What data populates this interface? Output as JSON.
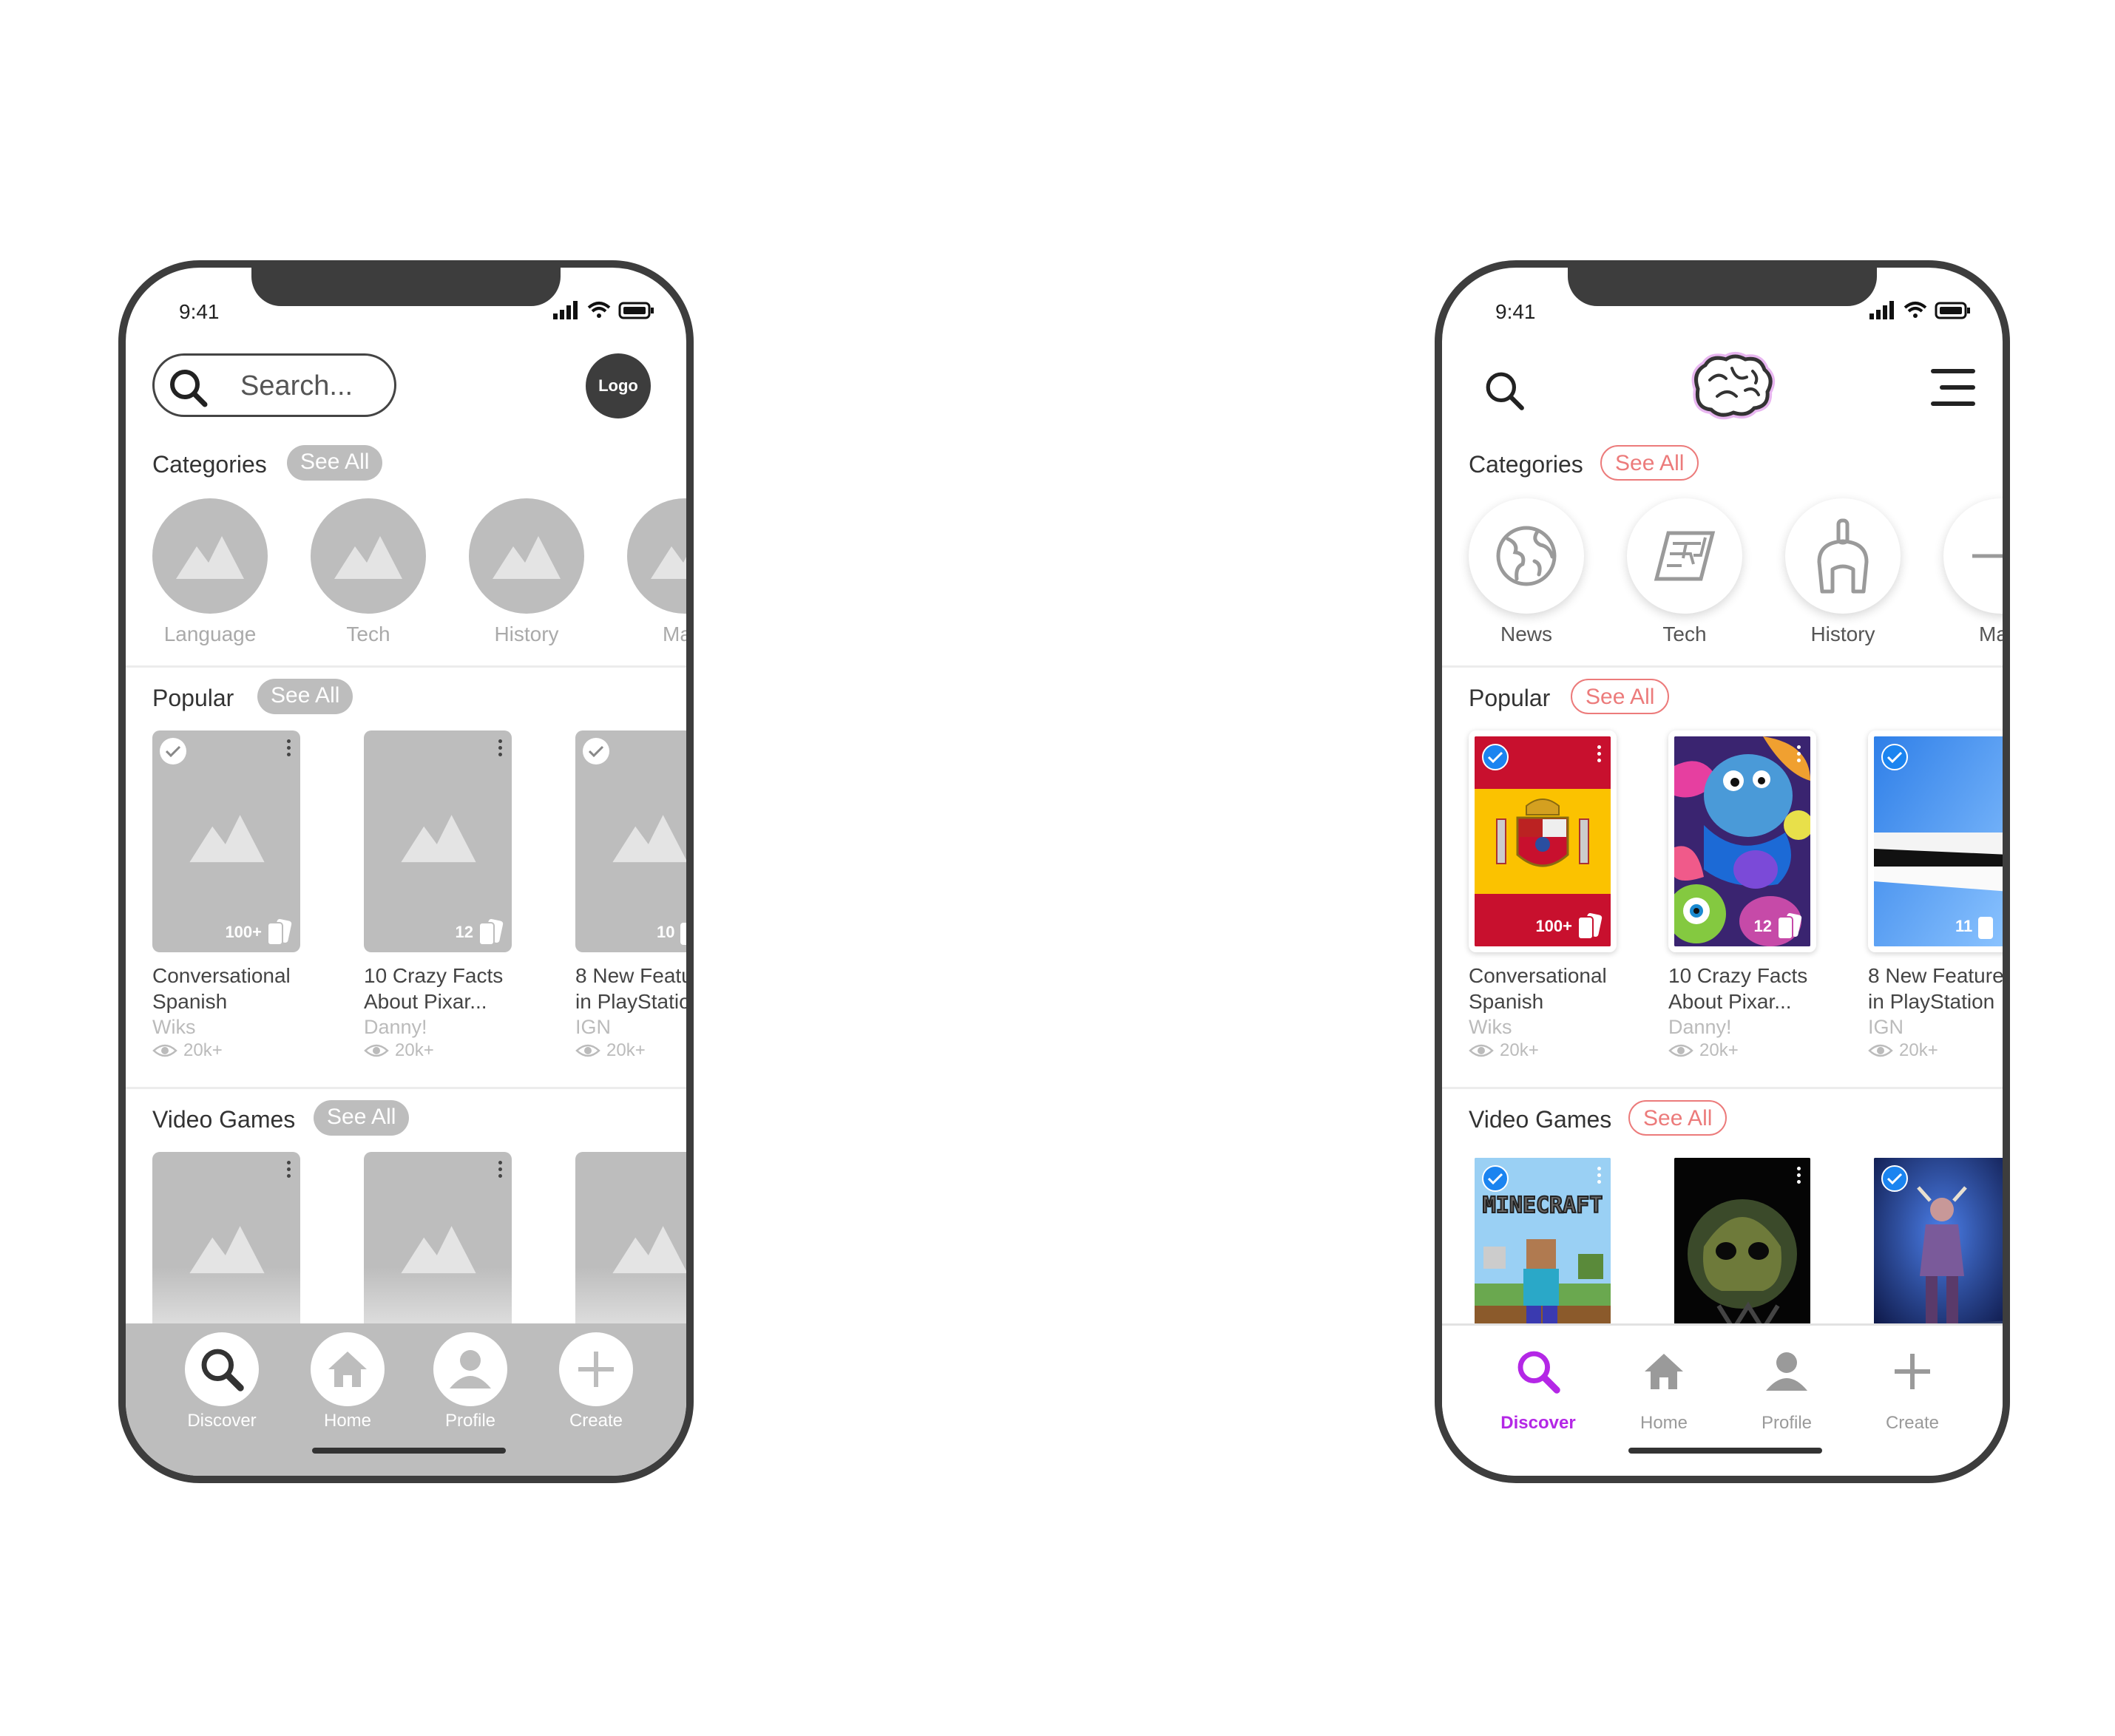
{
  "status": {
    "time": "9:41"
  },
  "search": {
    "placeholder": "Search..."
  },
  "logo_text": "Logo",
  "sections": {
    "categories": "Categories",
    "popular": "Popular",
    "video_games": "Video Games",
    "see_all": "See All"
  },
  "wire_categories": [
    "Language",
    "Tech",
    "History",
    "Ma"
  ],
  "hifi_categories": [
    "News",
    "Tech",
    "History",
    "Ma"
  ],
  "wire_popular": [
    {
      "title1": "Conversational",
      "title2": "Spanish",
      "author": "Wiks",
      "views": "20k+",
      "count": "100+",
      "checked": true
    },
    {
      "title1": "10 Crazy Facts",
      "title2": "About Pixar...",
      "author": "Danny!",
      "views": "20k+",
      "count": "12",
      "checked": false
    },
    {
      "title1": "8 New Featu",
      "title2": "in PlayStatio",
      "author": "IGN",
      "views": "20k+",
      "count": "10",
      "checked": true
    }
  ],
  "hifi_popular": [
    {
      "title1": "Conversational",
      "title2": "Spanish",
      "author": "Wiks",
      "views": "20k+",
      "count": "100+",
      "checked": true
    },
    {
      "title1": "10 Crazy Facts",
      "title2": "About Pixar...",
      "author": "Danny!",
      "views": "20k+",
      "count": "12",
      "checked": false
    },
    {
      "title1": "8 New Feature",
      "title2": "in PlayStation",
      "author": "IGN",
      "views": "20k+",
      "count": "11",
      "checked": true
    }
  ],
  "minecraft_text": "MINECRAFT",
  "tabs": [
    "Discover",
    "Home",
    "Profile",
    "Create"
  ],
  "colors": {
    "wire_gray": "#bdbdbd",
    "frame": "#3d3d3d",
    "accent_pink": "#ec7b7b",
    "accent_purple": "#b427e6",
    "check_blue": "#1b84f0"
  }
}
